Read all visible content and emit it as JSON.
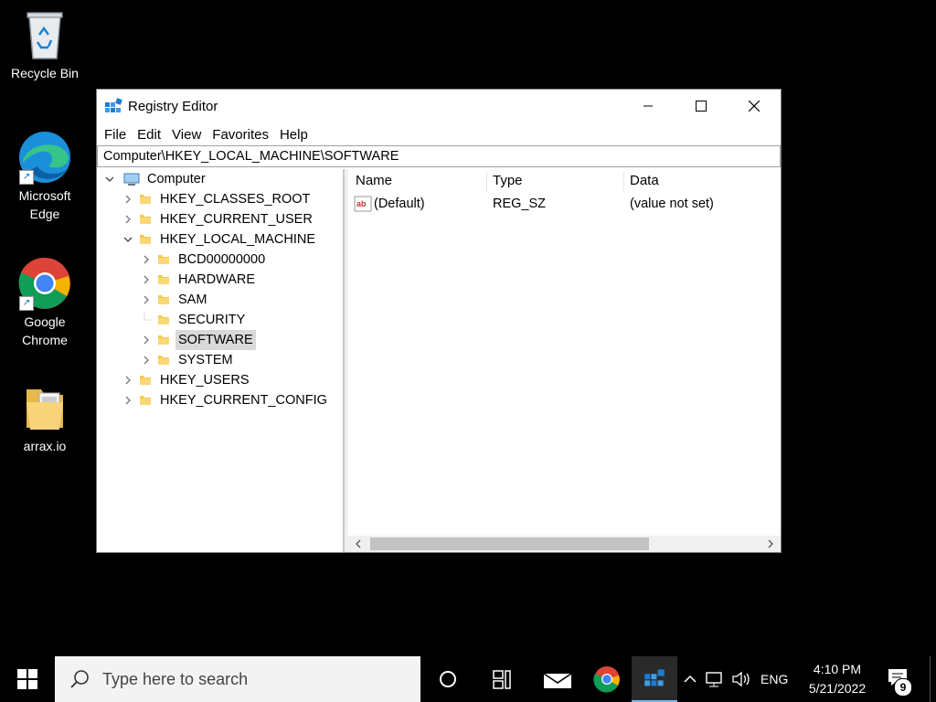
{
  "desktop": {
    "icons": [
      {
        "label": "Recycle Bin",
        "icon": "recycle-bin-icon"
      },
      {
        "label": "Microsoft Edge",
        "icon": "edge-icon"
      },
      {
        "label": "Google Chrome",
        "icon": "chrome-icon"
      },
      {
        "label": "arrax.io",
        "icon": "folder-icon"
      }
    ]
  },
  "window": {
    "title": "Registry Editor",
    "menu": [
      "File",
      "Edit",
      "View",
      "Favorites",
      "Help"
    ],
    "address": "Computer\\HKEY_LOCAL_MACHINE\\SOFTWARE",
    "tree": {
      "root": "Computer",
      "nodes": [
        {
          "label": "HKEY_CLASSES_ROOT",
          "level": 1,
          "expander": "collapsed"
        },
        {
          "label": "HKEY_CURRENT_USER",
          "level": 1,
          "expander": "collapsed"
        },
        {
          "label": "HKEY_LOCAL_MACHINE",
          "level": 1,
          "expander": "expanded"
        },
        {
          "label": "BCD00000000",
          "level": 2,
          "expander": "collapsed"
        },
        {
          "label": "HARDWARE",
          "level": 2,
          "expander": "collapsed"
        },
        {
          "label": "SAM",
          "level": 2,
          "expander": "collapsed"
        },
        {
          "label": "SECURITY",
          "level": 2,
          "expander": "none"
        },
        {
          "label": "SOFTWARE",
          "level": 2,
          "expander": "collapsed",
          "selected": true
        },
        {
          "label": "SYSTEM",
          "level": 2,
          "expander": "collapsed"
        },
        {
          "label": "HKEY_USERS",
          "level": 1,
          "expander": "collapsed"
        },
        {
          "label": "HKEY_CURRENT_CONFIG",
          "level": 1,
          "expander": "collapsed"
        }
      ]
    },
    "list": {
      "columns": [
        "Name",
        "Type",
        "Data"
      ],
      "rows": [
        {
          "name": "(Default)",
          "type": "REG_SZ",
          "data": "(value not set)",
          "icon": "string-value-icon"
        }
      ]
    }
  },
  "taskbar": {
    "search_placeholder": "Type here to search",
    "language": "ENG",
    "time": "4:10 PM",
    "date": "5/21/2022",
    "notification_count": "9"
  },
  "colors": {
    "accent": "#76b9ed",
    "folder": "#f5c94c",
    "selection": "#d9d9d9"
  }
}
